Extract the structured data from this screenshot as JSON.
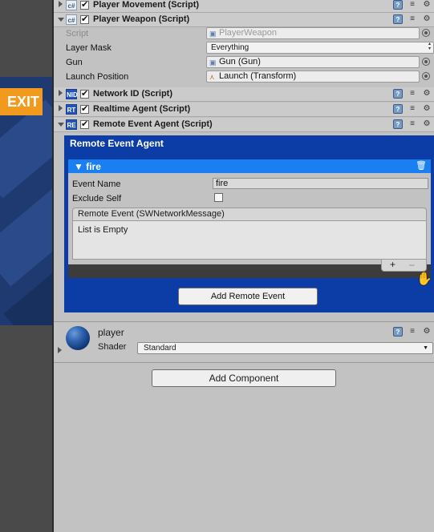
{
  "game": {
    "exit_label": "EXIT"
  },
  "components": {
    "player_movement": {
      "title": "Player Movement (Script)",
      "icon": "script-icon",
      "enabled": true
    },
    "player_weapon": {
      "title": "Player Weapon (Script)",
      "icon": "script-icon",
      "enabled": true,
      "props": {
        "script_label": "Script",
        "script_value": "PlayerWeapon",
        "layer_mask_label": "Layer Mask",
        "layer_mask_value": "Everything",
        "gun_label": "Gun",
        "gun_value": "Gun (Gun)",
        "launch_label": "Launch Position",
        "launch_value": "Launch (Transform)"
      }
    },
    "network_id": {
      "title": "Network ID (Script)",
      "icon_text": "NID",
      "enabled": true
    },
    "realtime_agent": {
      "title": "Realtime Agent (Script)",
      "icon_text": "RT",
      "enabled": true
    },
    "remote_event_agent": {
      "title": "Remote Event Agent (Script)",
      "icon_text": "RE",
      "enabled": true
    }
  },
  "remote_event_panel": {
    "title": "Remote Event Agent",
    "event": {
      "name": "fire",
      "event_name_label": "Event Name",
      "event_name_value": "fire",
      "exclude_self_label": "Exclude Self",
      "exclude_self": false,
      "list_header": "Remote Event (SWNetworkMessage)",
      "list_empty": "List is Empty",
      "add_symbol": "+",
      "remove_symbol": "–"
    },
    "add_button": "Add Remote Event"
  },
  "material": {
    "name": "player",
    "shader_label": "Shader",
    "shader_value": "Standard"
  },
  "add_component_button": "Add Component",
  "colors": {
    "accent": "#0c3da6",
    "event_header": "#1a7ff0",
    "exit": "#f29a1e"
  }
}
